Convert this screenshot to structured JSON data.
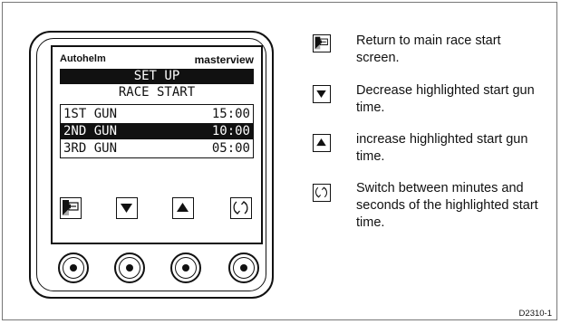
{
  "device": {
    "brand_left": "Autohelm",
    "brand_right": "masterview",
    "title": "SET UP",
    "subtitle": "RACE START",
    "guns": [
      {
        "name": "1ST GUN",
        "time": "15:00",
        "highlighted": false
      },
      {
        "name": "2ND GUN",
        "time": "10:00",
        "highlighted": true
      },
      {
        "name": "3RD GUN",
        "time": "05:00",
        "highlighted": false
      }
    ],
    "soft_keys": [
      "return-icon",
      "triangle-down-icon",
      "triangle-up-icon",
      "cycle-arrows-icon"
    ]
  },
  "legend": [
    {
      "icon": "return-icon",
      "text": "Return to main race start screen."
    },
    {
      "icon": "triangle-down-icon",
      "text": "Decrease highlighted start gun time."
    },
    {
      "icon": "triangle-up-icon",
      "text": "increase highlighted start gun time."
    },
    {
      "icon": "cycle-arrows-icon",
      "text": "Switch between minutes and seconds of the highlighted start time."
    }
  ],
  "figure_id": "D2310-1"
}
